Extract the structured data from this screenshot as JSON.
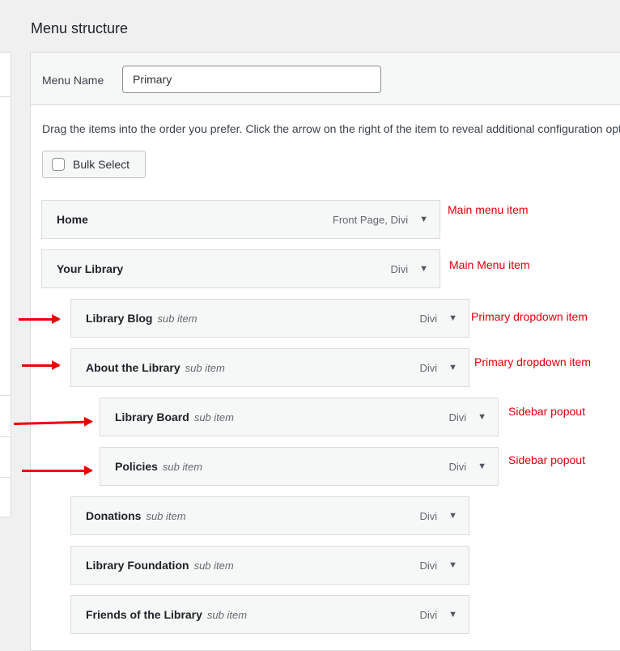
{
  "header": {
    "title": "Menu structure"
  },
  "menu_name": {
    "label": "Menu Name",
    "value": "Primary"
  },
  "instructions": "Drag the items into the order you prefer. Click the arrow on the right of the item to reveal additional configuration options.",
  "bulk_select": {
    "label": "Bulk Select"
  },
  "items": [
    {
      "title": "Home",
      "sub": "",
      "type": "Front Page, Divi",
      "depth": 0,
      "note": "Main menu item"
    },
    {
      "title": "Your Library",
      "sub": "",
      "type": "Divi",
      "depth": 0,
      "note": "Main Menu item"
    },
    {
      "title": "Library Blog",
      "sub": "sub item",
      "type": "Divi",
      "depth": 1,
      "note": "Primary dropdown item"
    },
    {
      "title": "About the Library",
      "sub": "sub item",
      "type": "Divi",
      "depth": 1,
      "note": "Primary dropdown item"
    },
    {
      "title": "Library Board",
      "sub": "sub item",
      "type": "Divi",
      "depth": 2,
      "note": "Sidebar popout"
    },
    {
      "title": "Policies",
      "sub": "sub item",
      "type": "Divi",
      "depth": 2,
      "note": "Sidebar popout"
    },
    {
      "title": "Donations",
      "sub": "sub item",
      "type": "Divi",
      "depth": 1,
      "note": ""
    },
    {
      "title": "Library Foundation",
      "sub": "sub item",
      "type": "Divi",
      "depth": 1,
      "note": ""
    },
    {
      "title": "Friends of the Library",
      "sub": "sub item",
      "type": "Divi",
      "depth": 1,
      "note": ""
    }
  ],
  "arrow_glyph": "▼",
  "annotation_color": "#e0000a"
}
